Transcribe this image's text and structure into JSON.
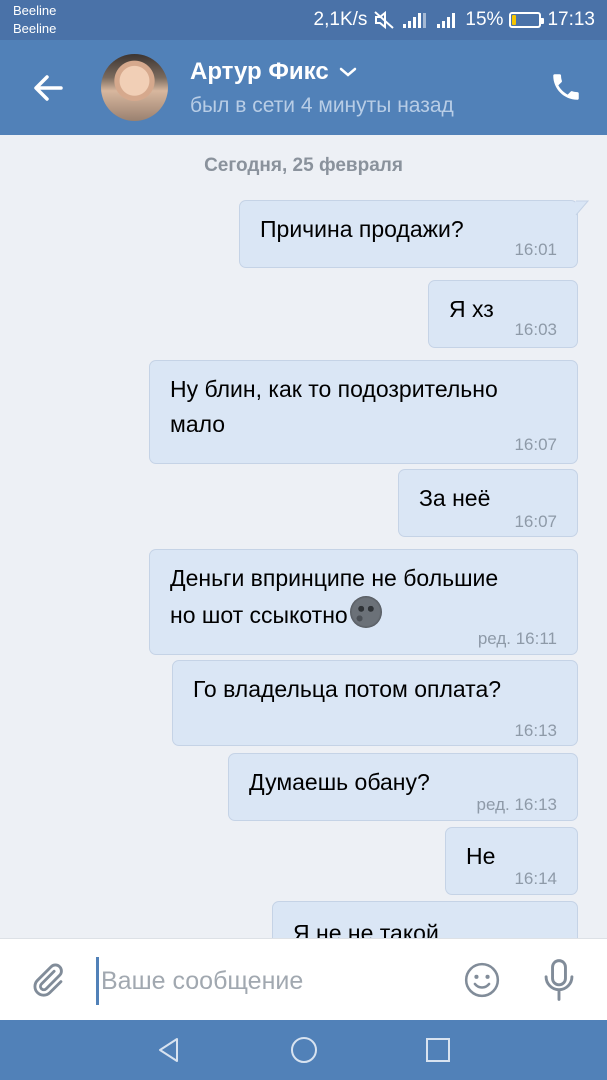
{
  "status_bar": {
    "carrier_1": "Beeline",
    "carrier_2": "Beeline",
    "net_speed": "2,1K/s",
    "battery": "15%",
    "battery_level": 0.15,
    "time": "17:13",
    "icons": [
      "mute-icon",
      "signal-icon",
      "signal-icon",
      "battery-icon"
    ]
  },
  "header": {
    "name": "Артур Фикс",
    "status": "был в сети 4 минуты назад",
    "icons": [
      "back-arrow-icon",
      "avatar",
      "chevron-down-icon",
      "phone-icon"
    ]
  },
  "chat": {
    "date_separator": "Сегодня, 25 февраля",
    "messages": [
      {
        "lines": [
          "Причина продажи?"
        ],
        "time": "16:01"
      },
      {
        "lines": [
          "Я хз"
        ],
        "time": "16:03"
      },
      {
        "lines": [
          "Ну блин, как то подозрительно",
          "мало"
        ],
        "time": "16:07"
      },
      {
        "lines": [
          "За неё"
        ],
        "time": "16:07"
      },
      {
        "lines": [
          "Деньги впринципе не большие",
          "но шот ссыкотно"
        ],
        "emoji": "new-moon-face-emoji",
        "time": "ред. 16:11"
      },
      {
        "lines": [
          "Го владельца потом оплата?"
        ],
        "time": "16:13"
      },
      {
        "lines": [
          "Думаешь обану?"
        ],
        "time": "ред. 16:13"
      },
      {
        "lines": [
          "Не"
        ],
        "time": "16:14"
      },
      {
        "lines": [
          "Я не не такой"
        ],
        "time": ""
      }
    ]
  },
  "input": {
    "placeholder": "Ваше сообщение",
    "value": "",
    "icons": [
      "paperclip-icon",
      "emoji-icon",
      "microphone-icon"
    ]
  },
  "nav_bar": {
    "icons": [
      "nav-back-icon",
      "nav-home-icon",
      "nav-recent-icon"
    ]
  },
  "colors": {
    "header": "#5181b8",
    "status_bar": "#4a72a8",
    "outgoing_bubble": "#dae6f5",
    "chat_background": "#edf0f5"
  }
}
